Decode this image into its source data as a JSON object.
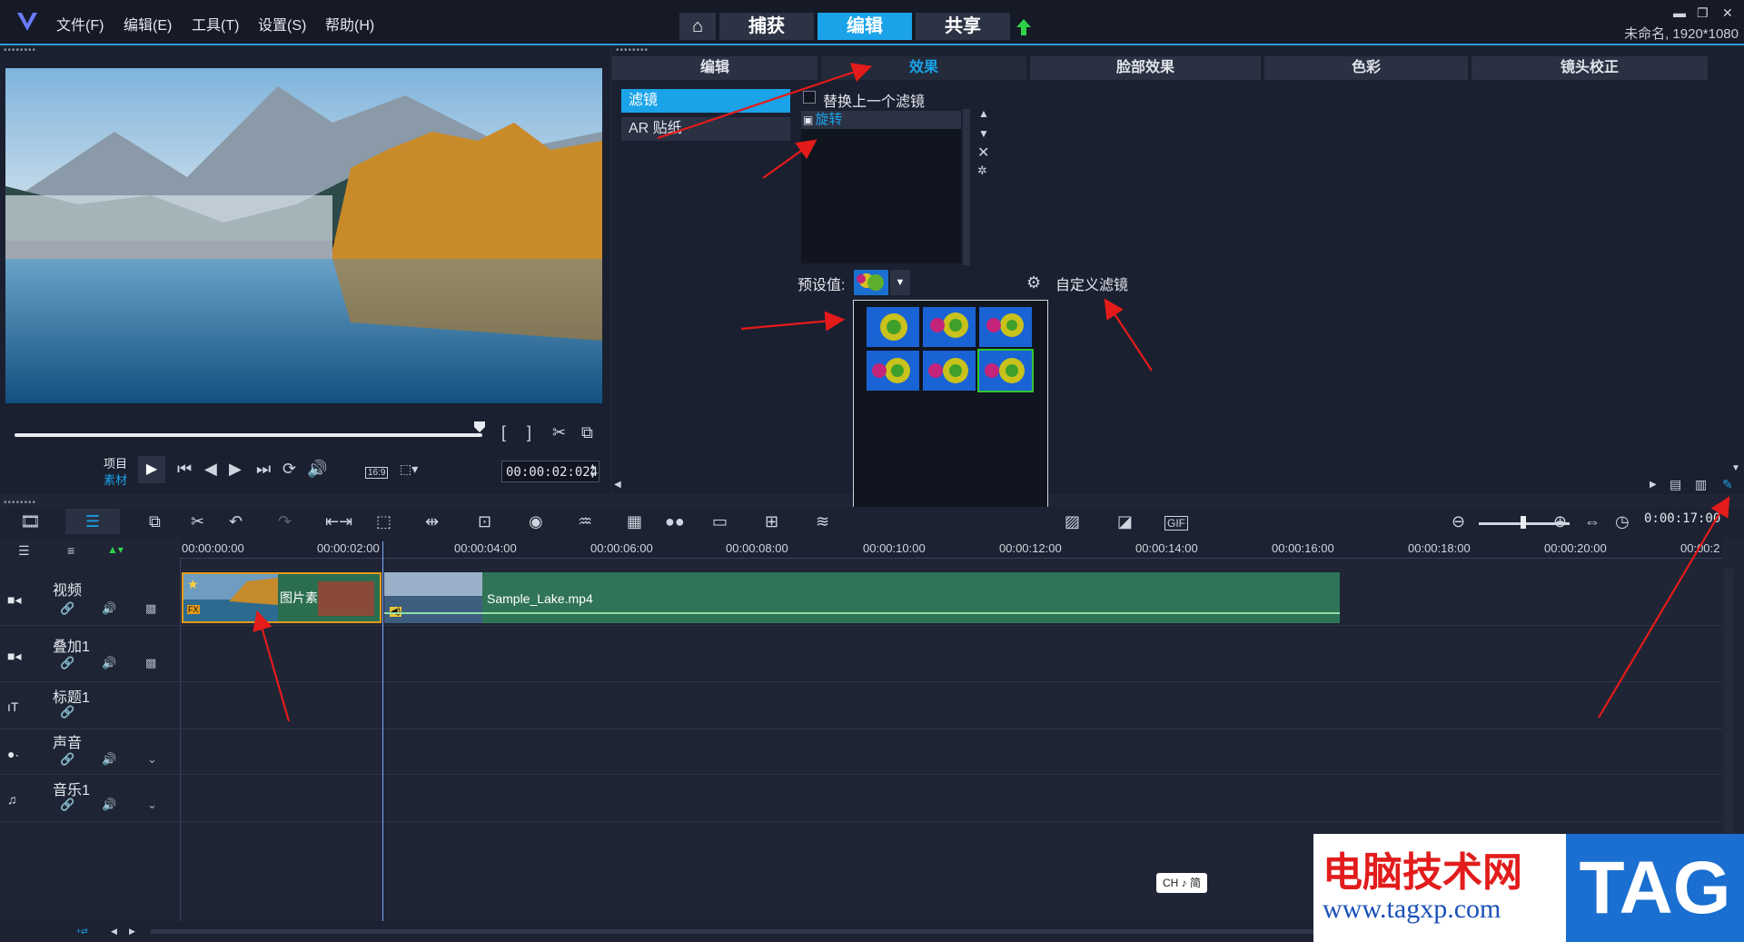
{
  "menubar": {
    "items": [
      "文件(F)",
      "编辑(E)",
      "工具(T)",
      "设置(S)",
      "帮助(H)"
    ],
    "tabs": [
      "捕获",
      "编辑",
      "共享"
    ],
    "active_tab": "编辑",
    "project_info": "未命名, 1920*1080"
  },
  "player": {
    "mode_project": "项目",
    "mode_clip": "素材",
    "timecode": "00:00:02:024",
    "aspect": "16:9"
  },
  "effects": {
    "tabs": [
      "编辑",
      "效果",
      "脸部效果",
      "色彩",
      "镜头校正"
    ],
    "active_tab": "效果",
    "categories": [
      "滤镜",
      "AR 贴纸"
    ],
    "replace_label": "替换上一个滤镜",
    "applied_filter": "旋转",
    "preset_label": "预设值:",
    "custom_filter": "自定义滤镜"
  },
  "timeline": {
    "timecode": "0:00:17:00",
    "ruler": [
      "00:00:00:00",
      "00:00:02:00",
      "00:00:04:00",
      "00:00:06:00",
      "00:00:08:00",
      "00:00:10:00",
      "00:00:12:00",
      "00:00:14:00",
      "00:00:16:00",
      "00:00:18:00",
      "00:00:20:00",
      "00:00:2"
    ],
    "tracks": [
      "视频",
      "叠加1",
      "标题1",
      "声音",
      "音乐1"
    ],
    "clip_image_label": "图片素",
    "clip_video_label": "Sample_Lake.mp4"
  },
  "watermark": {
    "title": "电脑技术网",
    "url": "www.tagxp.com",
    "tag": "TAG"
  },
  "ime": "CH ♪ 简",
  "colors": {
    "accent": "#1aa3e8",
    "annotation": "#e41b1b",
    "clip_green": "#2f7456"
  }
}
